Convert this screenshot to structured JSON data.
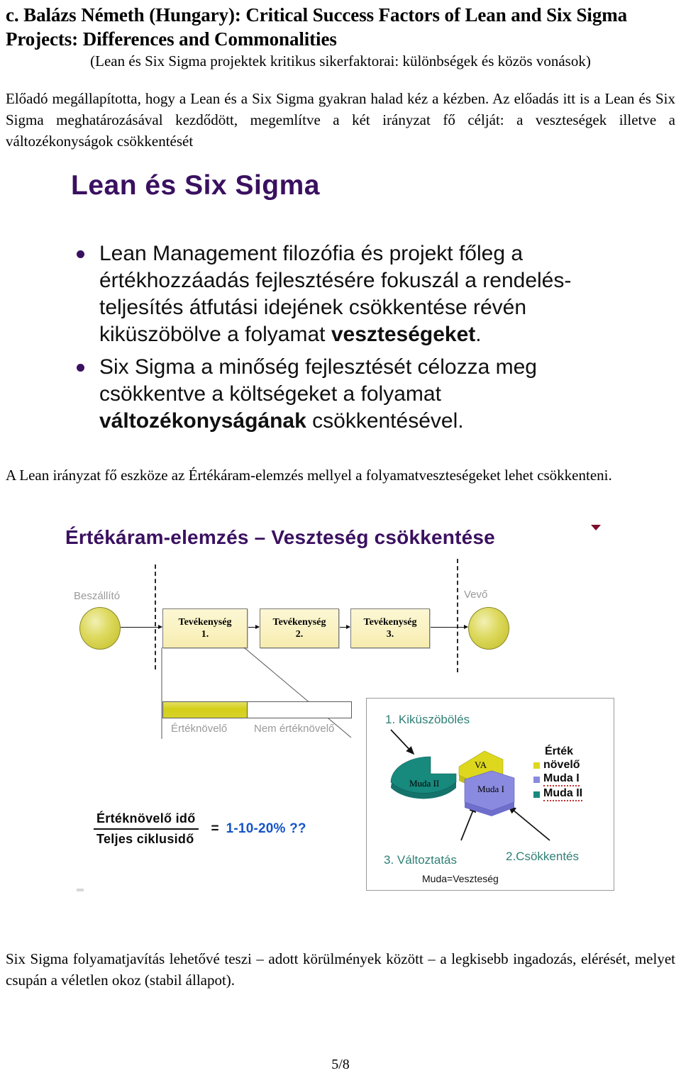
{
  "document": {
    "title": "c. Balázs Németh (Hungary): Critical Success Factors of Lean and Six Sigma Projects:   Differences and Commonalities",
    "subtitle": "(Lean és Six Sigma projektek kritikus sikerfaktorai: különbségek és közös vonások)",
    "paragraph_intro": "Előadó megállapította, hogy a Lean és a Six Sigma gyakran halad kéz a kézben. Az előadás itt is a Lean és Six Sigma meghatározásával kezdődött, megemlítve a két irányzat fő célját: a veszteségek illetve a változékonyságok csökkentését",
    "paragraph_middle": "A Lean irányzat fő eszköze az Értékáram-elemzés mellyel a folyamatveszteségeket lehet csökkenteni.",
    "paragraph_footer": "Six Sigma folyamatjavítás lehetővé teszi – adott körülmények között – a legkisebb ingadozás, elérését, melyet csupán a véletlen okoz (stabil állapot).",
    "page_number": "5/8",
    "accent_purple": "#3a1060"
  },
  "slide_one": {
    "title": "Lean és Six Sigma",
    "bullets": [
      {
        "pre": "Lean Management filozófia és projekt főleg a értékhozzáadás fejlesztésére fokuszál a rendelés-teljesítés átfutási idejének csökkentése révén kiküszöbölve a folyamat ",
        "bold": "veszteségeket",
        "post": "."
      },
      {
        "pre": "Six Sigma a minőség fejlesztését célozza meg csökkentve a költségeket a folyamat ",
        "bold": "változékonyságának",
        "post": " csökkentésével."
      }
    ]
  },
  "slide_two": {
    "title": "Értékáram-elemzés – Veszteség csökkentése",
    "value_stream": {
      "supplier_label": "Beszállító",
      "customer_label": "Vevő",
      "process_boxes": [
        {
          "line1": "Tevékenység",
          "line2": "1."
        },
        {
          "line1": "Tevékenység",
          "line2": "2."
        },
        {
          "line1": "Tevékenység",
          "line2": "3."
        }
      ],
      "bar_labels": {
        "value_added": "Értéknövelő",
        "non_value_added": "Nem értéknövelő"
      },
      "bar_split_percent": 45
    },
    "ratio": {
      "numerator": "Értéknövelő idő",
      "denominator": "Teljes ciklusidő",
      "equals": "=",
      "value": "1-10-20% ??",
      "value_color": "#1554c8"
    },
    "pie_panel": {
      "annotations": [
        {
          "id": "elimination",
          "label": "1. Kiküszöbölés"
        },
        {
          "id": "reduction",
          "label": "2.Csökkentés"
        },
        {
          "id": "change",
          "label": "3. Változtatás"
        }
      ],
      "caption": "Muda=Veszteség",
      "annotation_color": "#2f8076",
      "slice_labels": {
        "va": "VA",
        "muda_1": "Muda I",
        "muda_2": "Muda II"
      },
      "legend_title": "Érték",
      "legend": [
        {
          "label": "növelő",
          "color": "#ddd81e"
        },
        {
          "label": "Muda I",
          "color": "#8a8ae0"
        },
        {
          "label": "Muda II",
          "color": "#17897d"
        }
      ]
    },
    "chart_data": {
      "type": "pie",
      "title": "Érték",
      "categories": [
        "Érték növelő (VA)",
        "Muda I",
        "Muda II"
      ],
      "values": [
        12,
        28,
        60
      ],
      "colors": [
        "#ddd81e",
        "#8a8ae0",
        "#17897d"
      ],
      "labels_on_slices": [
        "VA",
        "Muda I",
        "Muda II"
      ],
      "legend_position": "right",
      "annotations": [
        "1. Kiküszöbölés",
        "2.Csökkentés",
        "3. Változtatás"
      ],
      "note": "Muda=Veszteség",
      "exploded": true,
      "three_d": true
    }
  }
}
